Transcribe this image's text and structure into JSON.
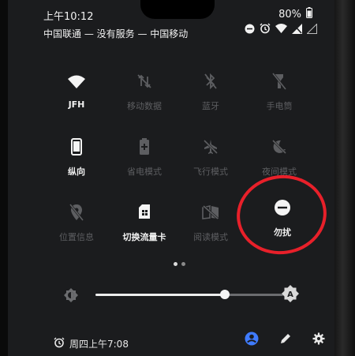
{
  "status_bar": {
    "time": "上午10:12",
    "battery": "80%",
    "carrier": "中国联通 — 没有服务 — 中国移动"
  },
  "tiles": [
    {
      "label": "JFH",
      "icon": "wifi-icon",
      "active": true
    },
    {
      "label": "移动数据",
      "icon": "mobile-data-off-icon",
      "active": false
    },
    {
      "label": "蓝牙",
      "icon": "bluetooth-off-icon",
      "active": false
    },
    {
      "label": "手电筒",
      "icon": "flashlight-off-icon",
      "active": false
    },
    {
      "label": "纵向",
      "icon": "portrait-icon",
      "active": true
    },
    {
      "label": "省电模式",
      "icon": "battery-saver-icon",
      "active": false
    },
    {
      "label": "飞行模式",
      "icon": "airplane-off-icon",
      "active": false
    },
    {
      "label": "夜间模式",
      "icon": "night-mode-off-icon",
      "active": false
    },
    {
      "label": "位置信息",
      "icon": "location-off-icon",
      "active": false
    },
    {
      "label": "切换流量卡",
      "icon": "sim-card-icon",
      "active": true
    },
    {
      "label": "阅读模式",
      "icon": "reading-mode-off-icon",
      "active": false
    },
    {
      "label": "勿扰",
      "icon": "do-not-disturb-icon",
      "active": true
    }
  ],
  "pager": {
    "pages": 2,
    "current": 1
  },
  "brightness": {
    "level": 0.69
  },
  "footer": {
    "alarm_text": "周四上午7:08"
  },
  "colors": {
    "accent": "#3f7bff",
    "annotation": "#e8202a",
    "panel": "#1b1c1e"
  }
}
